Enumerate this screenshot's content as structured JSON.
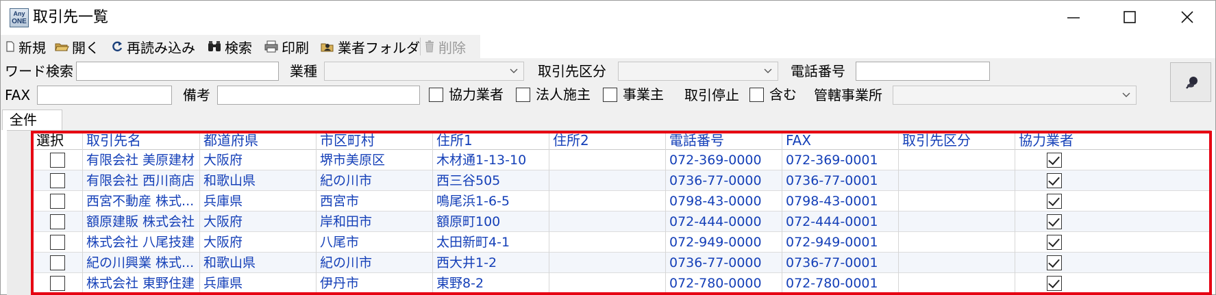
{
  "window": {
    "title": "取引先一覧",
    "logo_line1": "Any",
    "logo_line2": "ONE",
    "controls": [
      "minimize-icon",
      "maximize-icon",
      "close-icon"
    ]
  },
  "toolbar": {
    "new": "新規",
    "open": "開く",
    "reload": "再読み込み",
    "search": "検索",
    "print": "印刷",
    "vendor_folder": "業者フォルダ",
    "delete": "削除"
  },
  "filters": {
    "word_search_label": "ワード検索",
    "word_search_value": "",
    "industry_label": "業種",
    "industry_value": "",
    "client_category_label": "取引先区分",
    "client_category_value": "",
    "phone_label": "電話番号",
    "phone_value": "",
    "fax_label": "FAX",
    "fax_value": "",
    "memo_label": "備考",
    "memo_value": "",
    "partner_label": "協力業者",
    "corporate_owner_label": "法人施主",
    "business_owner_label": "事業主",
    "suspended_label": "取引停止",
    "include_label": "含む",
    "office_label": "管轄事業所",
    "office_value": ""
  },
  "tabs": [
    {
      "label": "全件"
    }
  ],
  "grid": {
    "columns": [
      "選択",
      "取引先名",
      "都道府県",
      "市区町村",
      "住所1",
      "住所2",
      "電話番号",
      "FAX",
      "取引先区分",
      "協力業者"
    ],
    "rows": [
      {
        "selected": false,
        "name": "有限会社 美原建材",
        "pref": "大阪府",
        "city": "堺市美原区",
        "addr1": "木材通1-13-10",
        "addr2": "",
        "phone": "072-369-0000",
        "fax": "072-369-0001",
        "category": "",
        "partner": true
      },
      {
        "selected": false,
        "name": "有限会社 西川商店",
        "pref": "和歌山県",
        "city": "紀の川市",
        "addr1": "西三谷505",
        "addr2": "",
        "phone": "0736-77-0000",
        "fax": "0736-77-0001",
        "category": "",
        "partner": true
      },
      {
        "selected": false,
        "name": "西宮不動産 株式...",
        "pref": "兵庫県",
        "city": "西宮市",
        "addr1": "鳴尾浜1-6-5",
        "addr2": "",
        "phone": "0798-43-0000",
        "fax": "0798-43-0001",
        "category": "",
        "partner": true
      },
      {
        "selected": false,
        "name": "額原建販 株式会社",
        "pref": "大阪府",
        "city": "岸和田市",
        "addr1": "額原町100",
        "addr2": "",
        "phone": "072-444-0000",
        "fax": "072-444-0001",
        "category": "",
        "partner": true
      },
      {
        "selected": false,
        "name": "株式会社 八尾技建",
        "pref": "大阪府",
        "city": "八尾市",
        "addr1": "太田新町4-1",
        "addr2": "",
        "phone": "072-949-0000",
        "fax": "072-949-0001",
        "category": "",
        "partner": true
      },
      {
        "selected": false,
        "name": "紀の川興業 株式...",
        "pref": "和歌山県",
        "city": "紀の川市",
        "addr1": "西大井1-2",
        "addr2": "",
        "phone": "0736-77-0000",
        "fax": "0736-77-0001",
        "category": "",
        "partner": true
      },
      {
        "selected": false,
        "name": "株式会社 東野住建",
        "pref": "兵庫県",
        "city": "伊丹市",
        "addr1": "東野8-2",
        "addr2": "",
        "phone": "072-780-0000",
        "fax": "072-780-0001",
        "category": "",
        "partner": true
      }
    ]
  },
  "colors": {
    "link_text": "#1540b8",
    "highlight": "#e60012",
    "alt_row": "#f3f6fb"
  }
}
